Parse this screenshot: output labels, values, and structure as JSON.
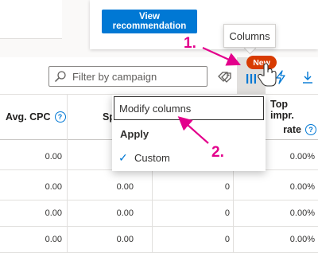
{
  "recommendation": {
    "button_label": "View recommendation"
  },
  "tooltip": {
    "text": "Columns"
  },
  "toolbar": {
    "search_placeholder": "Filter by campaign",
    "new_badge": "New",
    "icons": [
      "search-icon",
      "tag-icon",
      "columns-icon",
      "lightning-icon",
      "download-icon"
    ]
  },
  "annotations": {
    "step1": "1.",
    "step2": "2.",
    "color": "#e3008c"
  },
  "table": {
    "headers": {
      "avg_cpc": "Avg. CPC",
      "sp": "Sp",
      "top_impr_line1": "Top impr.",
      "top_impr_line2": "rate"
    },
    "rows": [
      {
        "avg_cpc": "0.00",
        "sp": "0.00",
        "blank": "0",
        "top_impr": "0.00%"
      },
      {
        "avg_cpc": "0.00",
        "sp": "0.00",
        "blank": "0",
        "top_impr": "0.00%"
      },
      {
        "avg_cpc": "0.00",
        "sp": "0.00",
        "blank": "0",
        "top_impr": "0.00%"
      },
      {
        "avg_cpc": "0.00",
        "sp": "0.00",
        "blank": "0",
        "top_impr": "0.00%"
      }
    ]
  },
  "dropdown": {
    "modify_columns": "Modify columns",
    "apply_heading": "Apply",
    "custom_label": "Custom",
    "check_glyph": "✓"
  },
  "colors": {
    "primary": "#0078d4",
    "badge": "#d83b01",
    "annotation": "#e3008c"
  }
}
